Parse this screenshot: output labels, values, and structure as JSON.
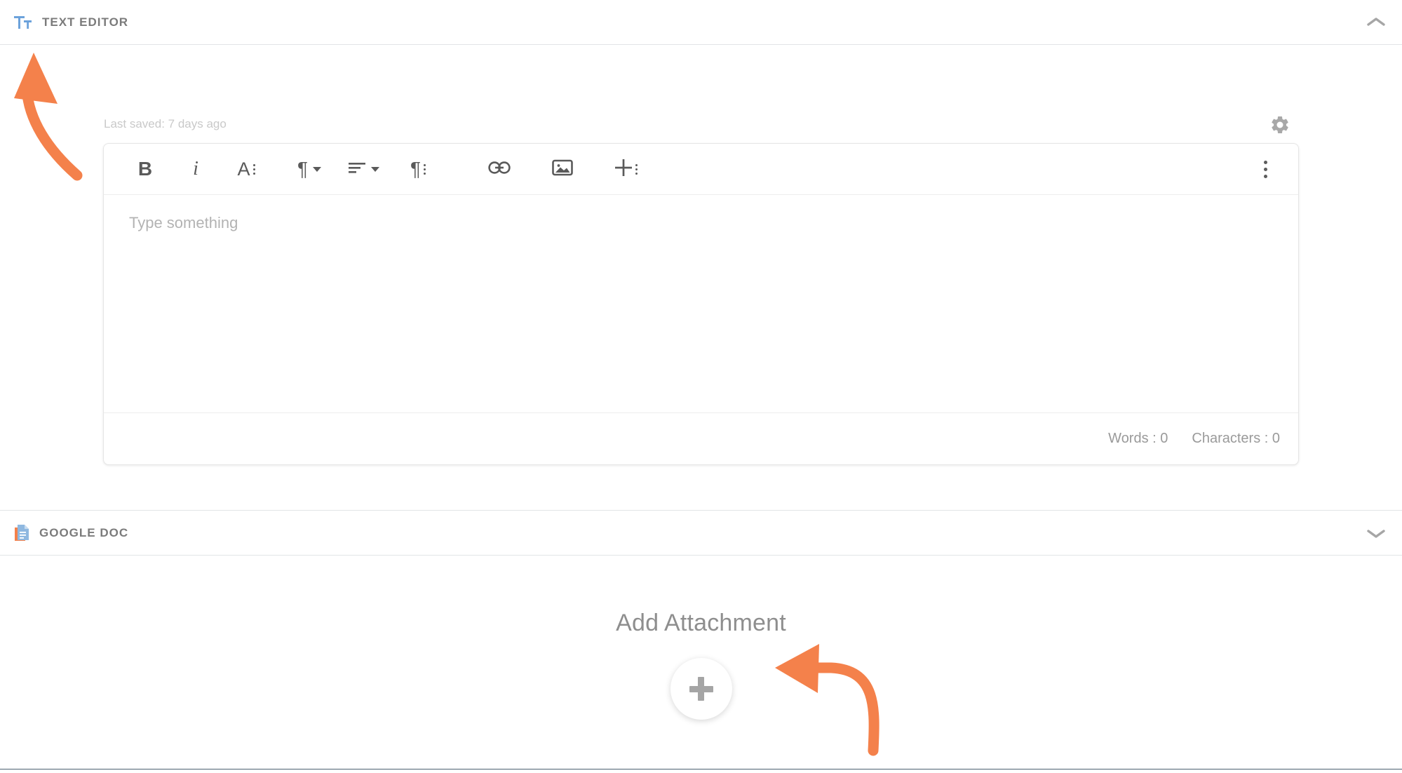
{
  "sections": [
    {
      "id": "text-editor",
      "title": "TEXT EDITOR",
      "icon": "text-format-icon",
      "collapse_state": "expanded",
      "chevron": "chevron-up-icon"
    },
    {
      "id": "google-doc",
      "title": "GOOGLE DOC",
      "icon": "google-doc-icon",
      "collapse_state": "collapsed",
      "chevron": "chevron-down-icon"
    }
  ],
  "editor": {
    "last_saved": "Last saved: 7 days ago",
    "settings_icon": "gear-icon",
    "overflow_icon": "more-vertical-icon",
    "placeholder": "Type something",
    "content": "",
    "toolbar": [
      {
        "name": "bold-button",
        "glyph": "B",
        "kind": "letter-b"
      },
      {
        "name": "italic-button",
        "glyph": "i",
        "kind": "letter-i"
      },
      {
        "name": "font-style-button",
        "glyph": "A",
        "kind": "letter-a-menu"
      },
      {
        "name": "paragraph-format-button",
        "glyph": "¶",
        "kind": "pilcrow-caret"
      },
      {
        "name": "text-align-button",
        "glyph": "align",
        "kind": "align-caret"
      },
      {
        "name": "paragraph-options-button",
        "glyph": "¶",
        "kind": "pilcrow-menu"
      },
      {
        "name": "insert-link-button",
        "glyph": "link",
        "kind": "link"
      },
      {
        "name": "insert-image-button",
        "glyph": "image",
        "kind": "image"
      },
      {
        "name": "insert-more-button",
        "glyph": "+",
        "kind": "plus-menu"
      }
    ],
    "counters": {
      "words": "Words : 0",
      "characters": "Characters : 0"
    }
  },
  "attachment": {
    "title": "Add Attachment",
    "add_button_label": "+",
    "add_button_icon": "plus-icon"
  },
  "annotations": [
    {
      "name": "annotation-arrow-text-editor-header",
      "direction": "up-left"
    },
    {
      "name": "annotation-arrow-add-attachment-button",
      "direction": "left"
    }
  ],
  "colors": {
    "accent_orange": "#F4814B",
    "icon_blue": "#6CA2DB",
    "title_gray": "#7B7B7B",
    "divider": "#E2E4E6"
  }
}
